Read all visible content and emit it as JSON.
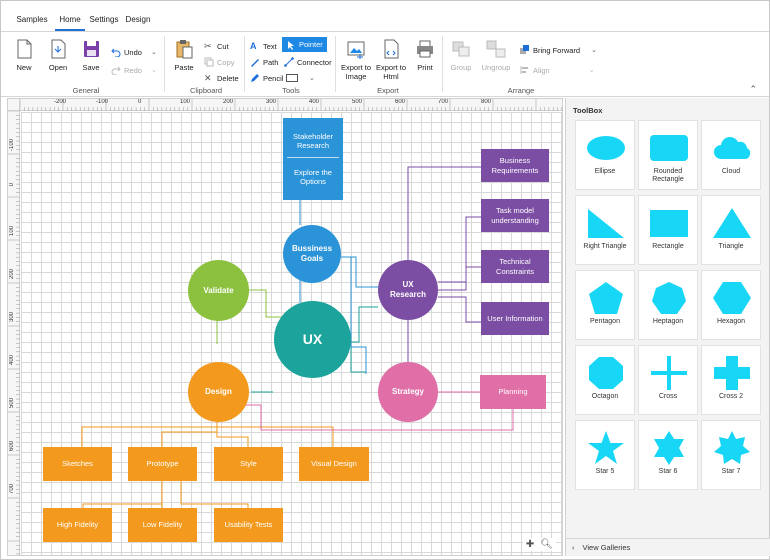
{
  "ribbon": {
    "tabs": [
      "Samples",
      "Home",
      "Settings",
      "Design"
    ],
    "active_tab": "Home",
    "groups": {
      "general": {
        "label": "General",
        "new": "New",
        "open": "Open",
        "save": "Save",
        "undo": "Undo",
        "redo": "Redo"
      },
      "clipboard": {
        "label": "Clipboard",
        "paste": "Paste",
        "cut": "Cut",
        "copy": "Copy",
        "delete": "Delete"
      },
      "tools": {
        "label": "Tools",
        "text": "Text",
        "path": "Path",
        "pencil": "Pencil",
        "pointer": "Pointer",
        "connector": "Connector"
      },
      "export": {
        "label": "Export",
        "export_image": "Export to Image",
        "export_html": "Export to Html",
        "print": "Print"
      },
      "arrange": {
        "label": "Arrange",
        "group": "Group",
        "ungroup": "Ungroup",
        "bring_forward": "Bring Forward",
        "align": "Align"
      }
    }
  },
  "ruler": {
    "h_ticks": [
      "-200",
      "-100",
      "0",
      "100",
      "200",
      "300",
      "400",
      "500",
      "600",
      "700",
      "800"
    ],
    "v_ticks": [
      "-100",
      "0",
      "100",
      "200",
      "300",
      "400",
      "500",
      "600",
      "700"
    ]
  },
  "diagram": {
    "stakeholder": {
      "line1": "Stakeholder Research",
      "line2": "Explore the Options"
    },
    "business_goals": "Bussiness Goals",
    "validate": "Validate",
    "ux": "UX",
    "ux_research": "UX Research",
    "design": "Design",
    "strategy": "Strategy",
    "planning": "Planning",
    "business_requirements": "Business Requirements",
    "task_model": "Task model understanding",
    "technical_constraints": "Technical Constraints",
    "user_information": "User Information",
    "sketches": "Sketches",
    "prototype": "Prototype",
    "style": "Style",
    "visual_design": "Visual Design",
    "high_fidelity": "High Fidelity",
    "low_fidelity": "Low Fidelity",
    "usability_tests": "Usability Tests"
  },
  "colors": {
    "blue": "#2b93d8",
    "green": "#8cc03f",
    "teal": "#1ba39c",
    "purple": "#7b4ea3",
    "orange": "#f39a1e",
    "pink": "#e06ea7",
    "shape_fill": "#18d6f5"
  },
  "toolbox": {
    "title": "ToolBox",
    "shapes": [
      "Ellipse",
      "Rounded Rectangle",
      "Cloud",
      "Right Triangle",
      "Rectangle",
      "Triangle",
      "Pentagon",
      "Heptagon",
      "Hexagon",
      "Octagon",
      "Cross",
      "Cross 2",
      "Star 5",
      "Star 6",
      "Star 7"
    ],
    "footer": "View Galleries"
  },
  "zoom": {
    "icons": [
      "plus-icon",
      "magnifier-icon"
    ]
  }
}
